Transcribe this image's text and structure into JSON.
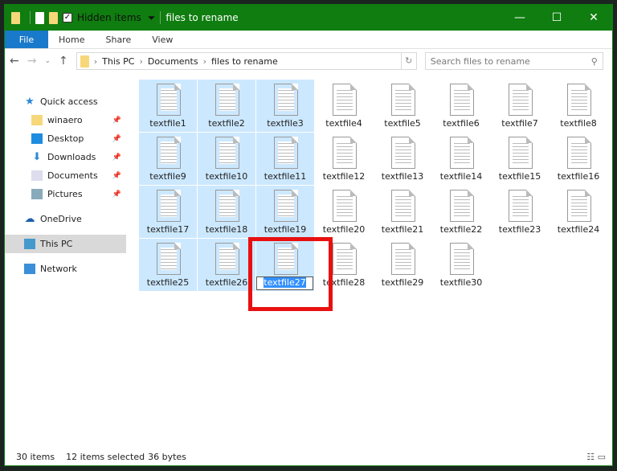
{
  "title": {
    "hidden_items_label": "Hidden items",
    "hidden_items_checked": true,
    "folder": "files to rename",
    "minimize": "—",
    "maximize": "☐",
    "close": "✕"
  },
  "ribbon": {
    "tabs": [
      "File",
      "Home",
      "Share",
      "View"
    ]
  },
  "address": {
    "crumbs": [
      "This PC",
      "Documents",
      "files to rename"
    ],
    "search_placeholder": "Search files to rename"
  },
  "sidebar": {
    "items": [
      {
        "label": "Quick access",
        "icon": "star-icon"
      },
      {
        "label": "winaero",
        "icon": "folder-icon",
        "pinned": true
      },
      {
        "label": "Desktop",
        "icon": "desktop-icon",
        "pinned": true
      },
      {
        "label": "Downloads",
        "icon": "download-icon",
        "pinned": true
      },
      {
        "label": "Documents",
        "icon": "documents-icon",
        "pinned": true
      },
      {
        "label": "Pictures",
        "icon": "pictures-icon",
        "pinned": true
      },
      {
        "label": "OneDrive",
        "icon": "cloud-icon"
      },
      {
        "label": "This PC",
        "icon": "computer-icon",
        "selected": true
      },
      {
        "label": "Network",
        "icon": "network-icon"
      }
    ]
  },
  "files": [
    "textfile1",
    "textfile2",
    "textfile3",
    "textfile4",
    "textfile5",
    "textfile6",
    "textfile7",
    "textfile8",
    "textfile9",
    "textfile10",
    "textfile11",
    "textfile12",
    "textfile13",
    "textfile14",
    "textfile15",
    "textfile16",
    "textfile17",
    "textfile18",
    "textfile19",
    "textfile20",
    "textfile21",
    "textfile22",
    "textfile23",
    "textfile24",
    "textfile25",
    "textfile26",
    "textfile27",
    "textfile28",
    "textfile29",
    "textfile30"
  ],
  "selected": [
    "textfile1",
    "textfile2",
    "textfile3",
    "textfile9",
    "textfile10",
    "textfile11",
    "textfile17",
    "textfile18",
    "textfile19",
    "textfile25",
    "textfile26",
    "textfile27"
  ],
  "renaming": "textfile27",
  "status": {
    "count": "30 items",
    "selected": "12 items selected",
    "size": "36 bytes"
  },
  "colors": {
    "titlebar": "#0f7d0f",
    "selection": "#cce8ff",
    "highlight": "#e81010"
  }
}
